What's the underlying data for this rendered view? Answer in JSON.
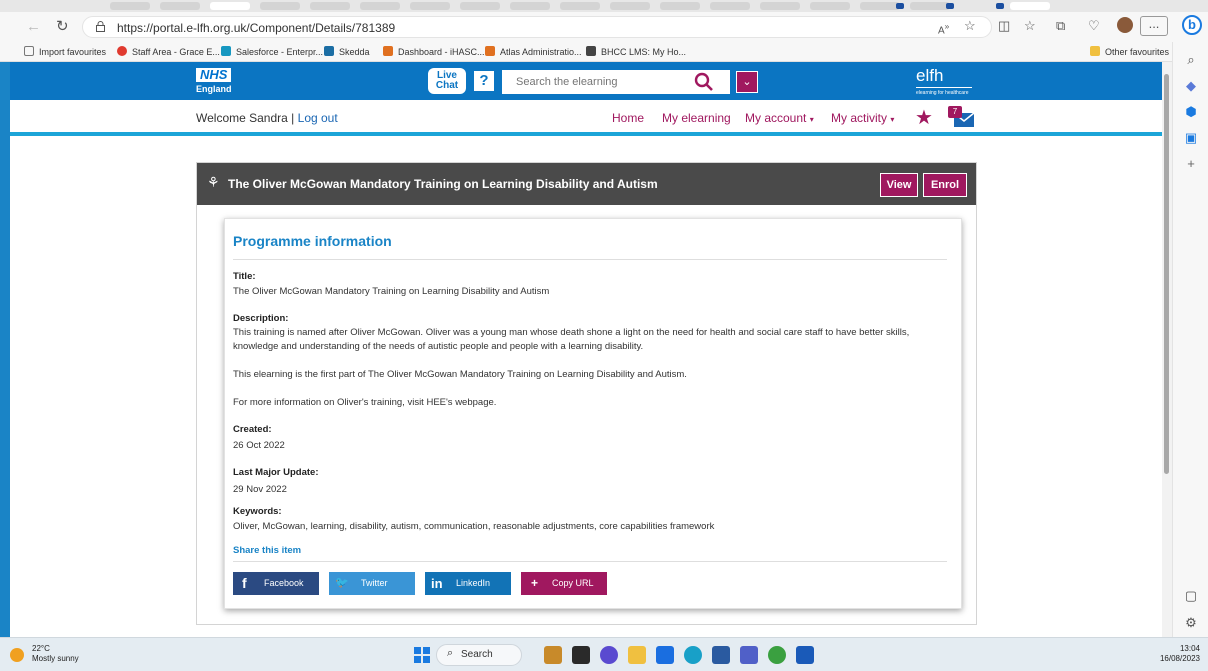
{
  "browser": {
    "url": "https://portal.e-lfh.org.uk/Component/Details/781389",
    "favourites": [
      {
        "label": "Import favourites",
        "color": "#777777"
      },
      {
        "label": "Staff Area - Grace E...",
        "color": "#e03a2f"
      },
      {
        "label": "Salesforce - Enterpr...",
        "color": "#1798c1"
      },
      {
        "label": "Skedda",
        "color": "#1c6ea4"
      },
      {
        "label": "Dashboard - iHASC...",
        "color": "#e07020"
      },
      {
        "label": "Atlas Administratio...",
        "color": "#e07020"
      },
      {
        "label": "BHCC LMS: My Ho...",
        "color": "#444444"
      }
    ],
    "other_favourites": "Other favourites",
    "more_label": "..."
  },
  "site": {
    "nhs_logo": "NHS",
    "nhs_region": "England",
    "live_chat_line1": "Live",
    "live_chat_line2": "Chat",
    "help_glyph": "?",
    "search_placeholder": "Search the elearning",
    "elfh_logo": "elfh",
    "elfh_tagline": "elearning for healthcare",
    "welcome_text": "Welcome Sandra",
    "separator": "|",
    "logout_label": "Log out",
    "nav": {
      "home": "Home",
      "my_elearning": "My elearning",
      "my_account": "My account",
      "my_activity": "My activity"
    },
    "mail_badge": "7"
  },
  "programme": {
    "title_bar": "The Oliver McGowan Mandatory Training on Learning Disability and Autism",
    "view_label": "View",
    "enrol_label": "Enrol",
    "heading": "Programme information",
    "title_label": "Title:",
    "title_value": "The Oliver McGowan Mandatory Training on Learning Disability and Autism",
    "description_label": "Description:",
    "description_p1": "This training is named after Oliver McGowan. Oliver was a young man whose death shone a light on the need for health and social care staff to have better skills, knowledge and understanding of the needs of autistic people and people with a learning disability.",
    "description_p2": "This elearning is the first part of The Oliver McGowan Mandatory Training on Learning Disability and Autism.",
    "description_p3": "For more information on Oliver's training, visit HEE's webpage.",
    "created_label": "Created:",
    "created_value": "26 Oct 2022",
    "updated_label": "Last Major Update:",
    "updated_value": "29 Nov 2022",
    "keywords_label": "Keywords:",
    "keywords_value": "Oliver, McGowan, learning, disability, autism, communication, reasonable adjustments, core capabilities framework",
    "share_label": "Share this item",
    "share_buttons": [
      {
        "label": "Facebook",
        "glyph": "f",
        "color": "#2b4a82"
      },
      {
        "label": "Twitter",
        "glyph": "🐦",
        "color": "#3a95d6"
      },
      {
        "label": "LinkedIn",
        "glyph": "in",
        "color": "#1273b6"
      },
      {
        "label": "Copy URL",
        "glyph": "+",
        "color": "#a0185f"
      }
    ]
  },
  "taskbar": {
    "temperature": "22°C",
    "weather": "Mostly sunny",
    "search_label": "Search",
    "time": "13:04",
    "date": "16/08/2023"
  }
}
